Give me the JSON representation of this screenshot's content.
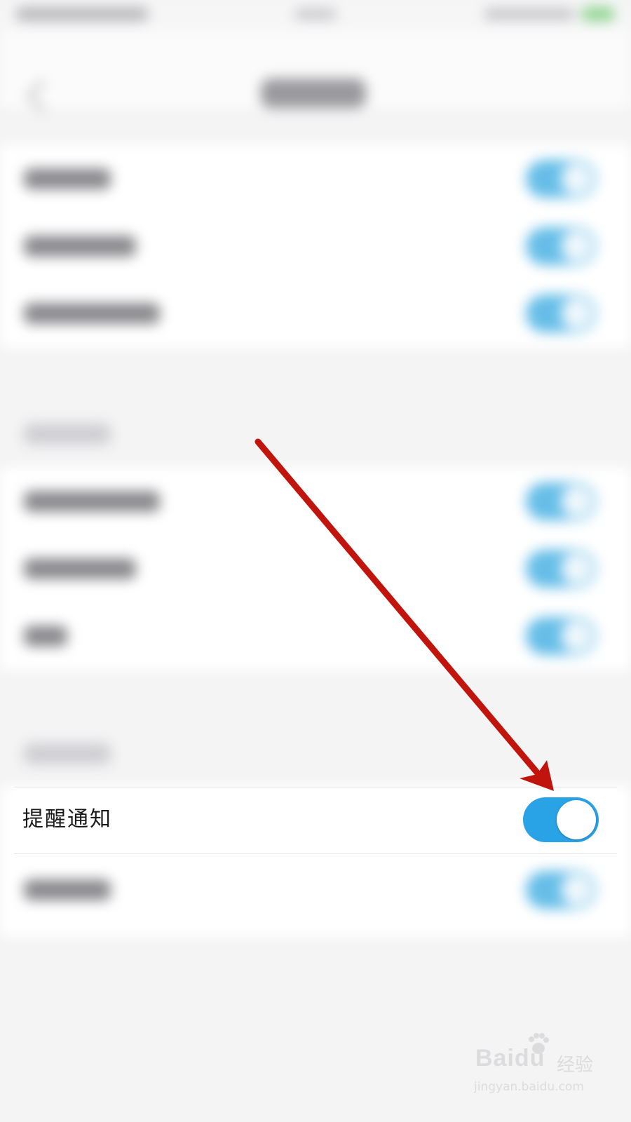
{
  "reminder": {
    "label": "提醒通知",
    "enabled": true,
    "toggle_on_color": "#2aa2e6",
    "toggle_knob_color": "#ffffff"
  },
  "annotation": {
    "arrow_color": "#c0140c",
    "arrow_icon": "arrow-annotation-icon"
  },
  "watermark": {
    "logo": "Baidu",
    "product": "经验",
    "url": "jingyan.baidu.com"
  }
}
